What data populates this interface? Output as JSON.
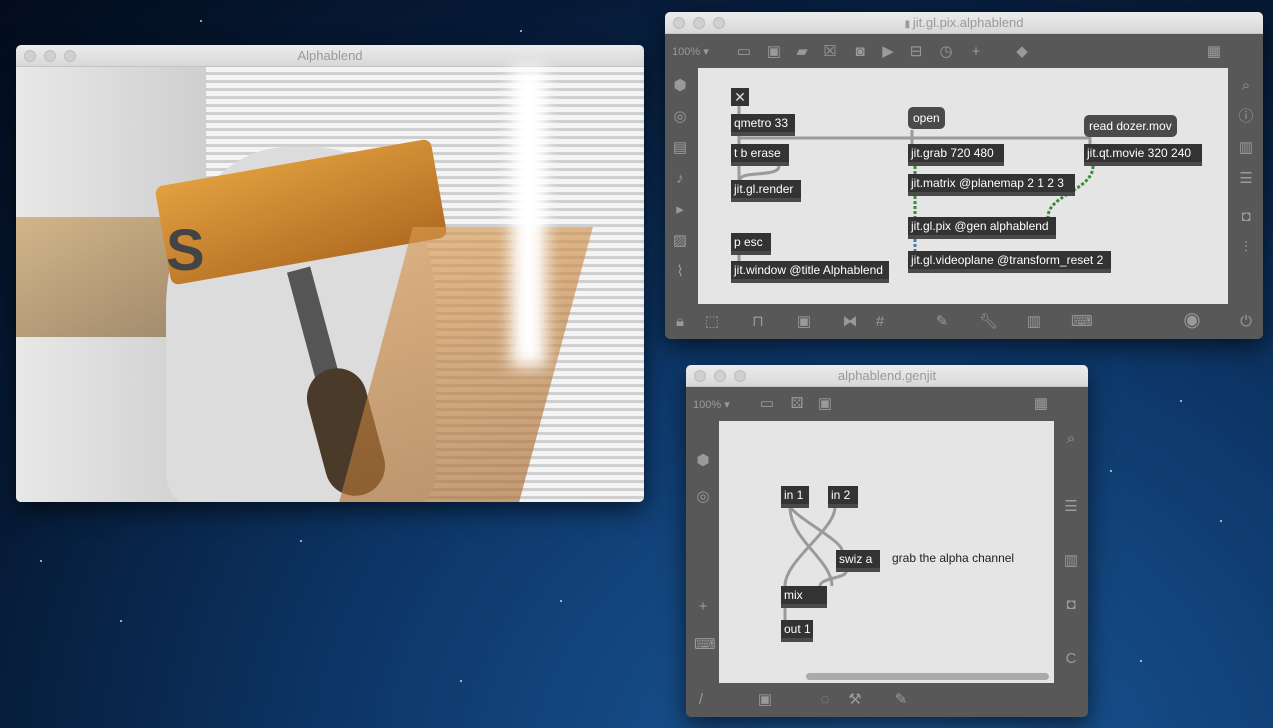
{
  "video_window": {
    "title": "Alphablend"
  },
  "patcher": {
    "title": "jit.gl.pix.alphablend",
    "zoom": "100%",
    "toggle": "✕",
    "objects": {
      "qmetro": "qmetro 33",
      "tb": "t b erase",
      "render": "jit.gl.render",
      "pesc": "p esc",
      "window": "jit.window @title Alphablend",
      "grab": "jit.grab 720 480",
      "matrix": "jit.matrix @planemap 2 1 2 3",
      "pix": "jit.gl.pix @gen alphablend",
      "videoplane": "jit.gl.videoplane @transform_reset 2",
      "movie": "jit.qt.movie 320 240"
    },
    "messages": {
      "open": "open",
      "read": "read dozer.mov"
    }
  },
  "genjit": {
    "title": "alphablend.genjit",
    "zoom": "100%",
    "objects": {
      "in1": "in 1",
      "in2": "in 2",
      "swiz": "swiz a",
      "mix": "mix",
      "out1": "out 1"
    },
    "comment": "grab the alpha channel"
  }
}
